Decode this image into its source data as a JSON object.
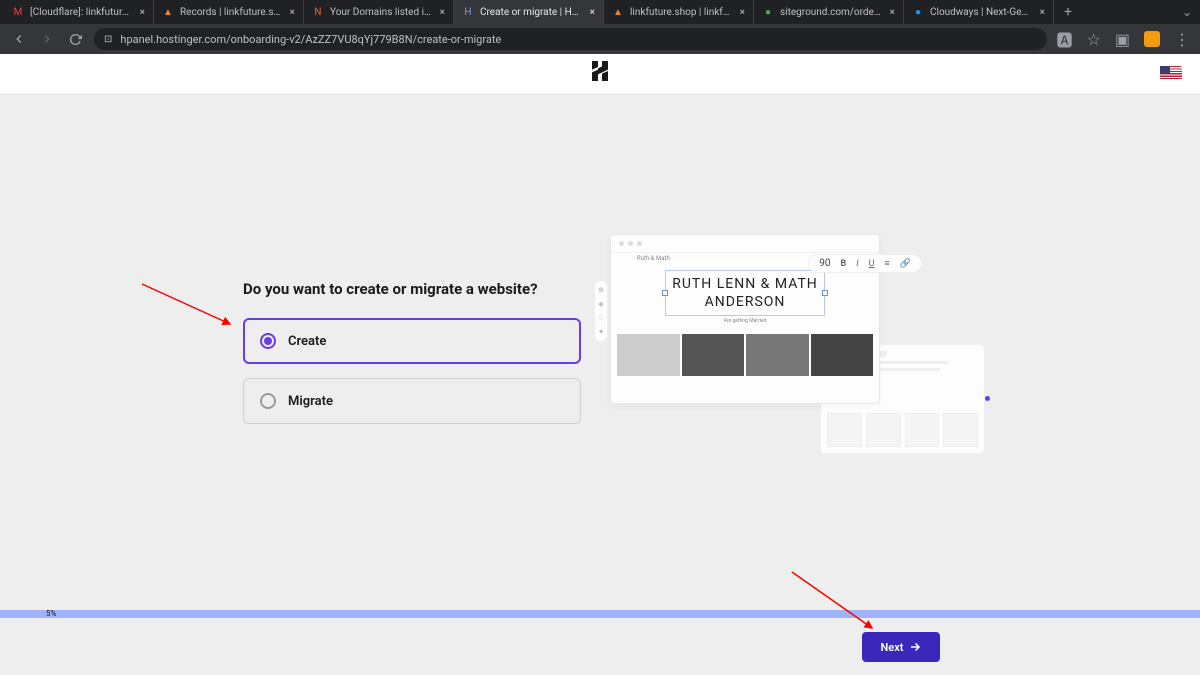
{
  "tabs": [
    {
      "favicon": "M",
      "favcolor": "#ea4335",
      "title": "[Cloudflare]: linkfuture.shop"
    },
    {
      "favicon": "▲",
      "favcolor": "#f48120",
      "title": "Records | linkfuture.shop | M"
    },
    {
      "favicon": "N",
      "favcolor": "#e85f3a",
      "title": "Your Domains listed in one pl"
    },
    {
      "favicon": "H",
      "favcolor": "#7a9cff",
      "title": "Create or migrate | Hostinger"
    },
    {
      "favicon": "▲",
      "favcolor": "#f48120",
      "title": "linkfuture.shop | linkfuture.sh"
    },
    {
      "favicon": "●",
      "favcolor": "#4caf50",
      "title": "siteground.com/order-verific"
    },
    {
      "favicon": "●",
      "favcolor": "#2196f3",
      "title": "Cloudways | Next-Gen Cloud"
    }
  ],
  "active_tab": 3,
  "url": "hpanel.hostinger.com/onboarding-v2/AzZZ7VU8qYj779B8N/create-or-migrate",
  "question": "Do you want to create or migrate a website?",
  "options": {
    "create": "Create",
    "migrate": "Migrate"
  },
  "selected_option": "create",
  "preview": {
    "brand": "Ruth & Math",
    "headline1": "RUTH LENN & MATH",
    "headline2": "ANDERSON",
    "subhead": "Are getting Married",
    "fontsize": "90"
  },
  "progress_pct": "5%",
  "next_label": "Next"
}
